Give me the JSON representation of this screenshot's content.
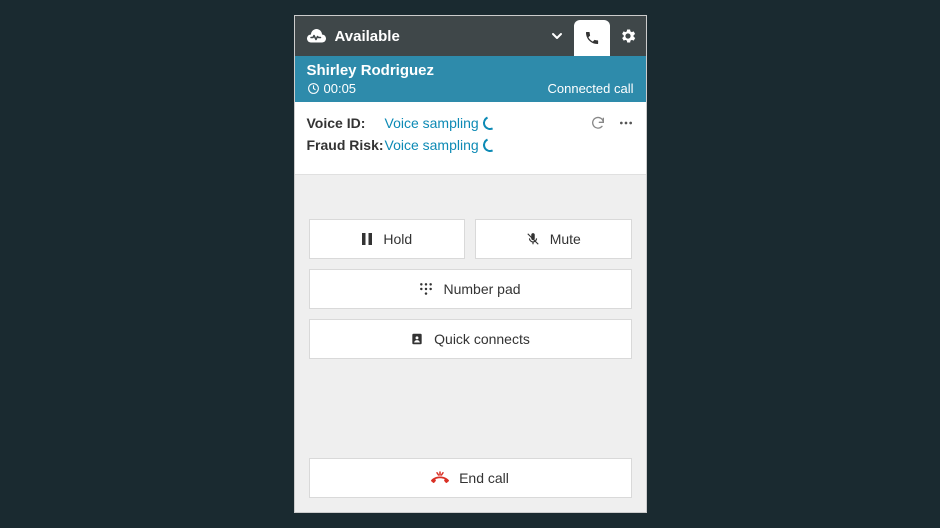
{
  "header": {
    "status": "Available",
    "icons": {
      "status": "heartbeat-cloud",
      "dropdown": "chevron-down",
      "phone": "phone",
      "settings": "gear"
    }
  },
  "caller": {
    "name": "Shirley Rodriguez",
    "timer": "00:05",
    "status": "Connected call"
  },
  "voice": {
    "voice_id_label": "Voice ID:",
    "voice_id_value": "Voice sampling",
    "fraud_risk_label": "Fraud Risk:",
    "fraud_risk_value": "Voice sampling"
  },
  "controls": {
    "hold": "Hold",
    "mute": "Mute",
    "number_pad": "Number pad",
    "quick_connects": "Quick connects",
    "end_call": "End call"
  },
  "colors": {
    "header_bg": "#3f4749",
    "caller_bg": "#2e8bab",
    "link": "#0d8ab5",
    "danger": "#d93025",
    "page_bg": "#1a2a30"
  }
}
